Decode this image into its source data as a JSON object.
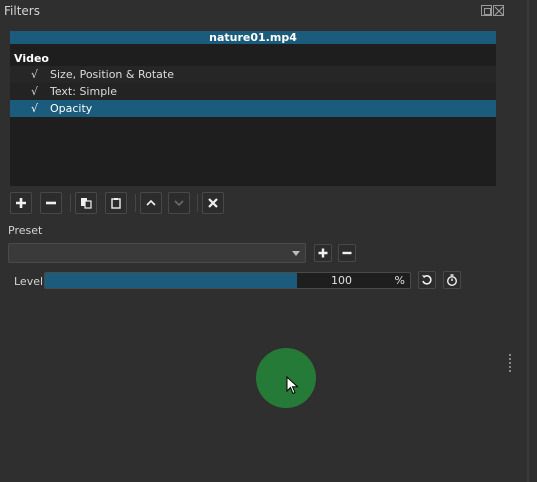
{
  "panel": {
    "title": "Filters"
  },
  "filter_list": {
    "clip_name": "nature01.mp4",
    "group_label": "Video",
    "items": [
      {
        "checked": "√",
        "label": "Size, Position & Rotate",
        "selected": false
      },
      {
        "checked": "√",
        "label": "Text: Simple",
        "selected": false
      },
      {
        "checked": "√",
        "label": "Opacity",
        "selected": true
      }
    ]
  },
  "toolbar": {
    "add_icon": "plus-icon",
    "remove_icon": "minus-icon",
    "copy_icon": "copy-icon",
    "paste_icon": "clipboard-icon",
    "move_up_icon": "chevron-up-icon",
    "move_down_icon": "chevron-down-icon",
    "deselect_icon": "close-icon"
  },
  "preset": {
    "label": "Preset",
    "value": ""
  },
  "level": {
    "label": "Level",
    "value": "100",
    "unit": "%",
    "fill_fraction": 0.69
  },
  "colors": {
    "accent": "#1b5b7b",
    "cursor_highlight": "#267a37",
    "background": "#2f2f2f"
  }
}
